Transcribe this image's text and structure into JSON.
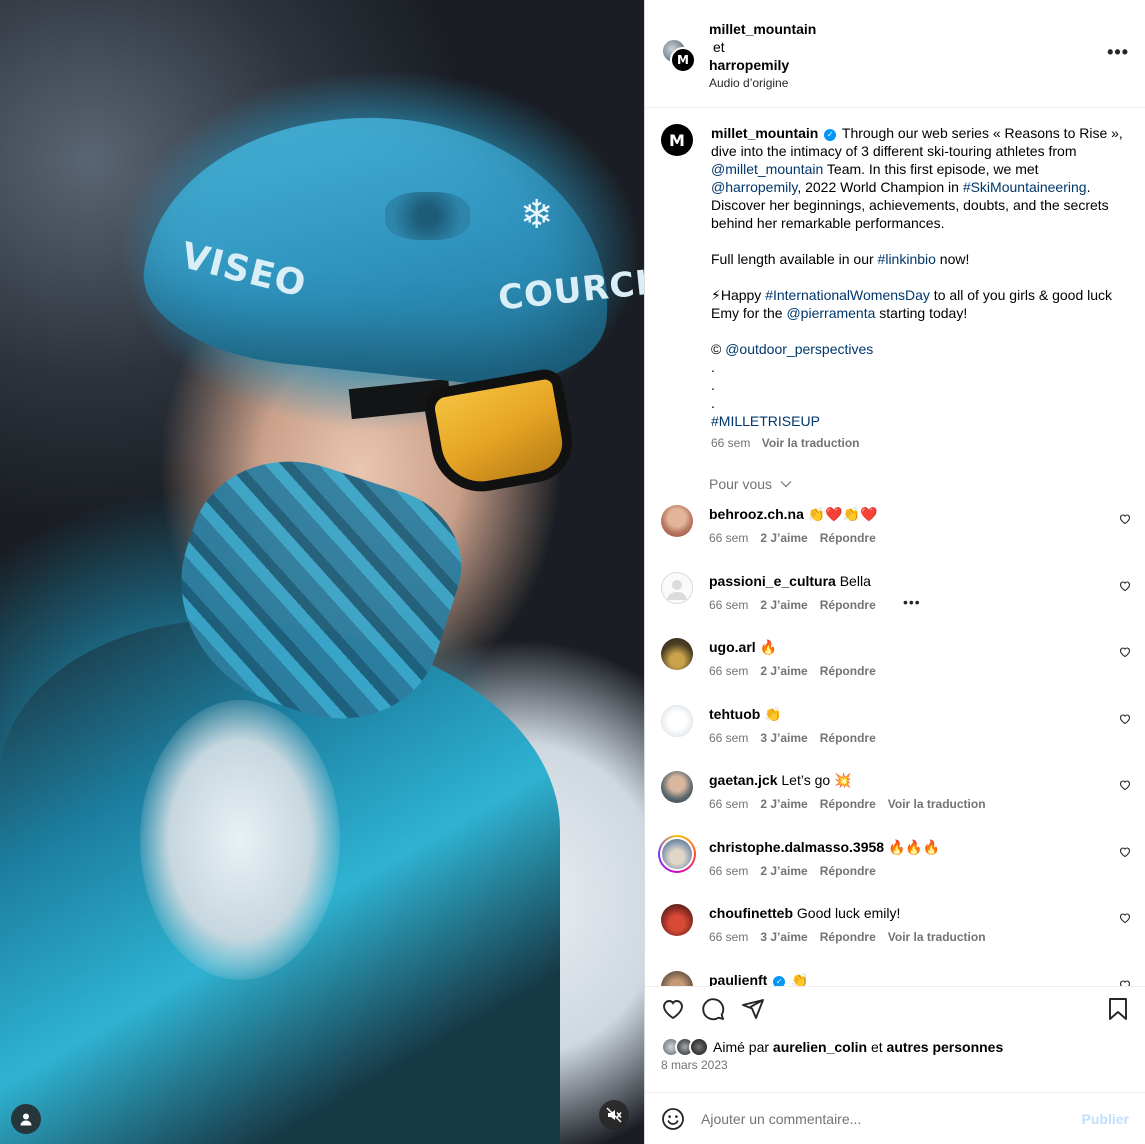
{
  "header": {
    "user1": "millet_mountain",
    "separator": "et",
    "user2": "harropemily",
    "audio": "Audio d’origine",
    "more": "•••"
  },
  "media": {
    "helmet_text_left": "VISEO",
    "helmet_text_right": "COURCH",
    "logo_letter": "M"
  },
  "caption": {
    "username": "millet_mountain",
    "lines": {
      "p1a": "Through our web series « Reasons to Rise », dive into the intimacy of 3 different ski-touring athletes from ",
      "mention1": "@millet_mountain",
      "p1b": " Team. In this first episode, we met ",
      "mention2": "@harropemily",
      "p1c": ", 2022 World Champion in ",
      "hashtag1": "#SkiMountaineering",
      "p1d": ". Discover her beginnings, achievements, doubts, and the secrets behind her remarkable performances.",
      "p2a": "Full length available in our ",
      "hashtag2": "#linkinbio",
      "p2b": " now!",
      "p3a": "⚡Happy ",
      "hashtag3": "#InternationalWomensDay",
      "p3b": " to all of you girls & good luck Emy for the ",
      "mention3": "@pierramenta",
      "p3c": " starting today!",
      "copyright": "©",
      "mention4": "@outdoor_perspectives",
      "dot": ".",
      "hashtag4": "#MILLETRISEUP"
    },
    "time": "66 sem",
    "translate": "Voir la traduction"
  },
  "for_you": "Pour vous",
  "comments": [
    {
      "user": "behrooz.ch.na",
      "text": "👏❤️👏❤️",
      "time": "66 sem",
      "likes": "2 J’aime",
      "reply": "Répondre",
      "translate": "",
      "avatar": "#b87560"
    },
    {
      "user": "passioni_e_cultura",
      "text": "Bella",
      "time": "66 sem",
      "likes": "2 J’aime",
      "reply": "Répondre",
      "translate": "",
      "avatar": "#e6e6e6"
    },
    {
      "user": "ugo.arl",
      "text": "🔥",
      "time": "66 sem",
      "likes": "2 J’aime",
      "reply": "Répondre",
      "translate": "",
      "avatar": "#6b5a3a"
    },
    {
      "user": "tehtuob",
      "text": "👏",
      "time": "66 sem",
      "likes": "3 J’aime",
      "reply": "Répondre",
      "translate": "",
      "avatar": "#eef2f5"
    },
    {
      "user": "gaetan.jck",
      "text": "Let’s go 💥",
      "time": "66 sem",
      "likes": "2 J’aime",
      "reply": "Répondre",
      "translate": "Voir la traduction",
      "avatar": "#5e6a70"
    },
    {
      "user": "christophe.dalmasso.3958",
      "text": "🔥🔥🔥",
      "time": "66 sem",
      "likes": "2 J’aime",
      "reply": "Répondre",
      "translate": "",
      "avatar": "#8d9fb3"
    },
    {
      "user": "choufinetteb",
      "text": "Good luck emily!",
      "time": "66 sem",
      "likes": "3 J’aime",
      "reply": "Répondre",
      "translate": "Voir la traduction",
      "avatar": "#8a2c22"
    },
    {
      "user": "paulienft",
      "text": "👏",
      "time": "",
      "likes": "",
      "reply": "",
      "translate": "",
      "avatar": "#6e5a48"
    }
  ],
  "liked_by": {
    "prefix": "Aimé par",
    "user": "aurelien_colin",
    "and": "et",
    "others": "autres personnes"
  },
  "date": "8 mars 2023",
  "add_comment": {
    "placeholder": "Ajouter un commentaire...",
    "post": "Publier"
  },
  "colors": {
    "link": "#00376b",
    "verified": "#0095f6",
    "secondary_text": "#737373",
    "post_disabled": "#c0dffd"
  }
}
